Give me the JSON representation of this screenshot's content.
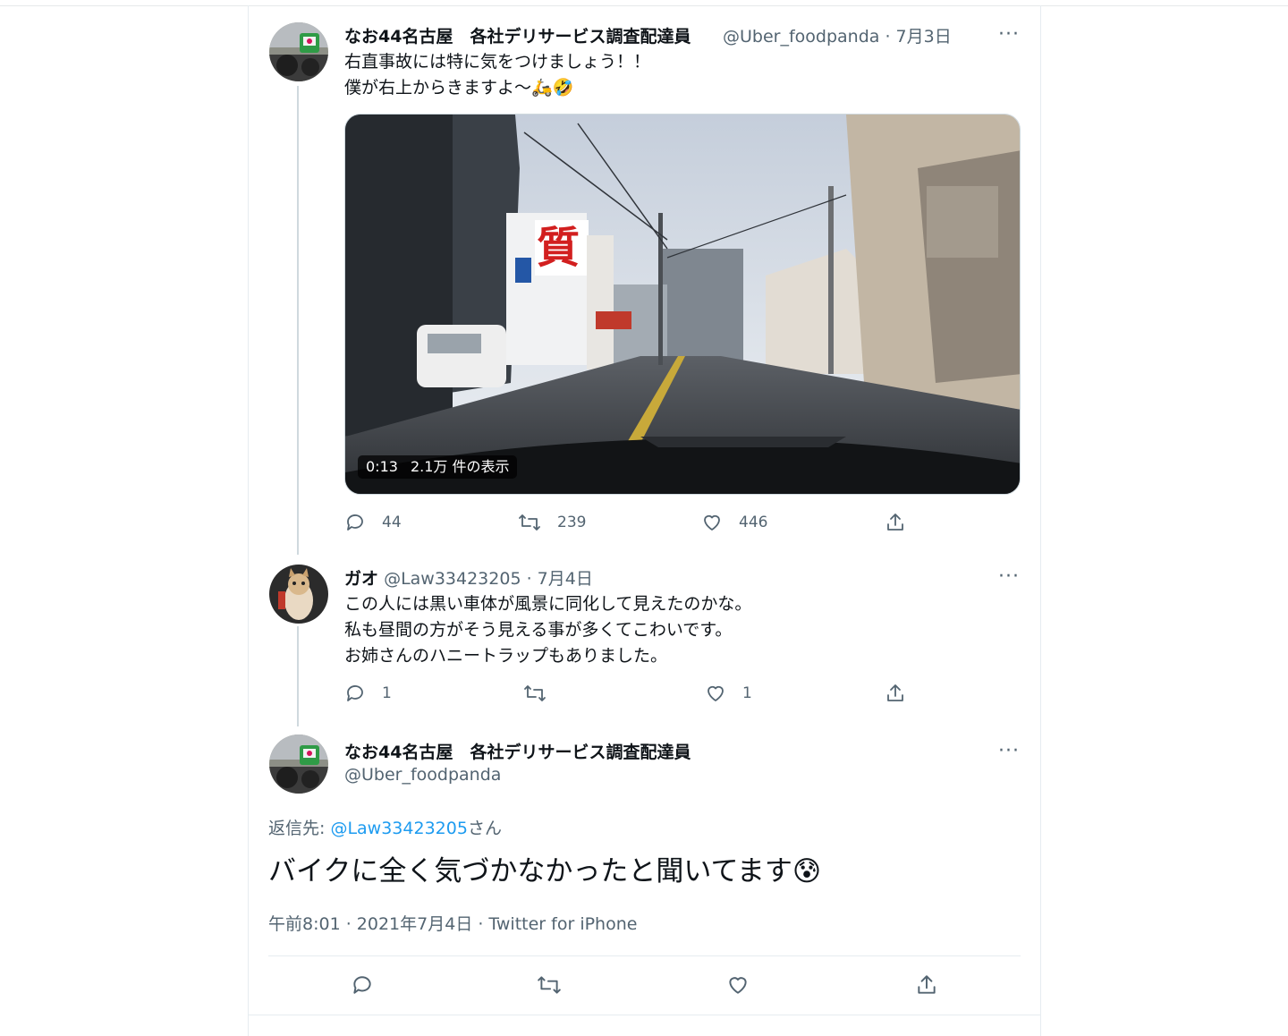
{
  "tweet1": {
    "name": "なお44名古屋　各社デリサービス調査配達員",
    "handle": "@Uber_foodpanda",
    "date": "· 7月3日",
    "more": "···",
    "lines": [
      "右直事故には特に気をつけましょう！！",
      "僕が右上からきますよ〜🛵🤣"
    ],
    "media": {
      "duration": "0:13",
      "views": "2.1万 件の表示"
    },
    "actions": {
      "replies": "44",
      "retweets": "239",
      "likes": "446"
    }
  },
  "tweet2": {
    "name": "ガオ",
    "handle": "@Law33423205",
    "date": "· 7月4日",
    "more": "···",
    "lines": [
      "この人には黒い車体が風景に同化して見えたのかな。",
      "私も昼間の方がそう見える事が多くてこわいです。",
      "お姉さんのハニートラップもありました。"
    ],
    "actions": {
      "replies": "1",
      "retweets": "",
      "likes": "1"
    }
  },
  "main_tweet": {
    "name": "なお44名古屋　各社デリサービス調査配達員",
    "handle": "@Uber_foodpanda",
    "more": "···",
    "reply_prefix": "返信先: ",
    "reply_handle": "@Law33423205",
    "reply_suffix": "さん",
    "text": "バイクに全く気づかなかったと聞いてます😰",
    "timestamp": "午前8:01 · 2021年7月4日 · Twitter for iPhone"
  },
  "colors": {
    "link": "#1d9bf0",
    "secondary": "#536471",
    "thread_line": "#cfd9de"
  }
}
